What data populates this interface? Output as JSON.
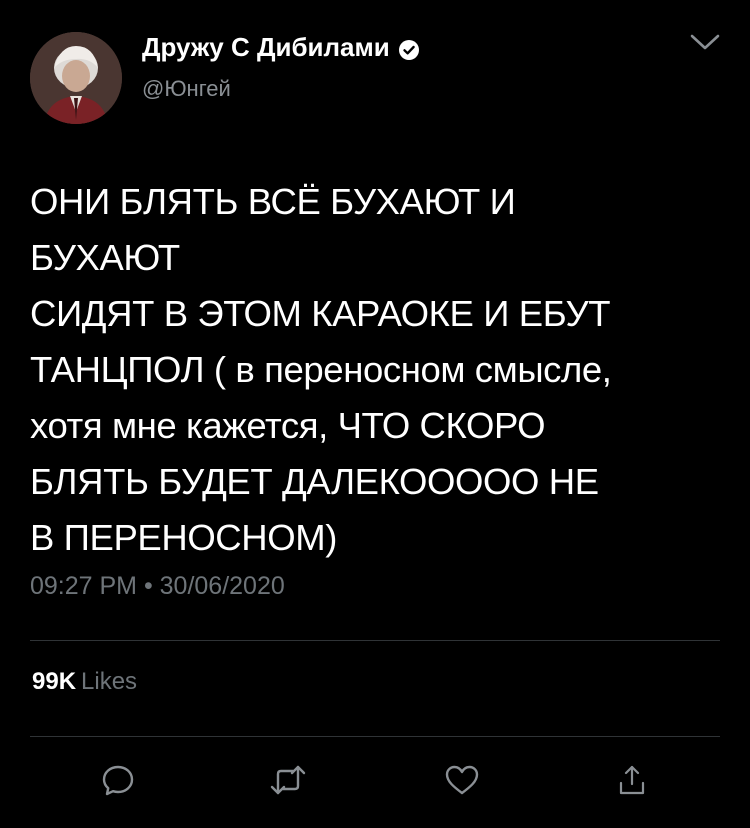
{
  "header": {
    "display_name": "Дружу С Дибилами",
    "handle": "@Юнгей",
    "verified_icon": "verified-badge-icon",
    "more_icon": "chevron-down-icon"
  },
  "tweet": {
    "text": "ОНИ БЛЯТЬ ВСЁ БУХАЮТ И\nБУХАЮТ\nСИДЯТ В ЭТОМ КАРАОКЕ И ЕБУТ\nТАНЦПОЛ ( в переносном смысле,\nхотя мне кажется, ЧТО СКОРО\nБЛЯТЬ БУДЕТ ДАЛЕКООООО НЕ\nВ ПЕРЕНОСНОМ)",
    "timestamp": "09:27 PM • 30/06/2020"
  },
  "stats": {
    "likes_count": "99K",
    "likes_label": "Likes"
  },
  "actions": {
    "reply_icon": "reply-icon",
    "retweet_icon": "retweet-icon",
    "like_icon": "heart-icon",
    "share_icon": "share-icon"
  },
  "colors": {
    "background": "#000000",
    "text": "#ffffff",
    "muted": "#6e7479",
    "divider": "#2f3336",
    "icon": "#8a8f94"
  }
}
